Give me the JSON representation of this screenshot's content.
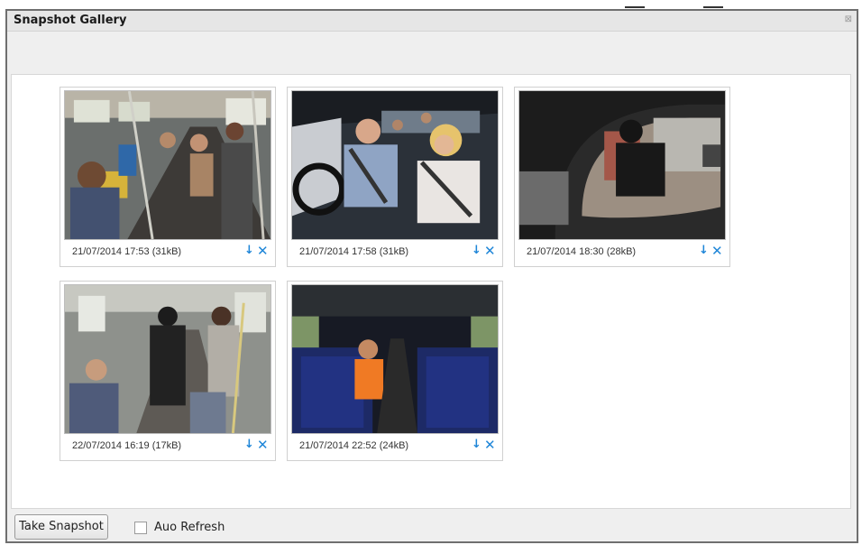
{
  "window": {
    "title": "Snapshot Gallery",
    "close_glyph": "⊠"
  },
  "snapshots": [
    {
      "caption": "21/07/2014 17:53  (31kB)",
      "download_glyph": "↓",
      "delete_glyph": "✕"
    },
    {
      "caption": "21/07/2014 17:58  (31kB)",
      "download_glyph": "↓",
      "delete_glyph": "✕"
    },
    {
      "caption": "21/07/2014 18:30  (28kB)",
      "download_glyph": "↓",
      "delete_glyph": "✕"
    },
    {
      "caption": "22/07/2014 16:19  (17kB)",
      "download_glyph": "↓",
      "delete_glyph": "✕"
    },
    {
      "caption": "21/07/2014 22:52  (24kB)",
      "download_glyph": "↓",
      "delete_glyph": "✕"
    }
  ],
  "footer": {
    "take_snapshot_label": "Take Snapshot",
    "auto_refresh_label": "Auo Refresh",
    "auto_refresh_checked": false
  },
  "colors": {
    "accent": "#1f86d8",
    "frame": "#6f6f6f"
  }
}
